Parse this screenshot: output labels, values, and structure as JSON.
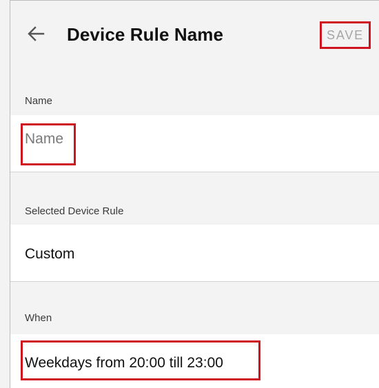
{
  "toolbar": {
    "back_icon": "arrow-left-icon",
    "title": "Device Rule Name",
    "save_label": "SAVE"
  },
  "name_section": {
    "header": "Name",
    "placeholder": "Name",
    "value": ""
  },
  "rule_section": {
    "header": "Selected Device Rule",
    "value": "Custom"
  },
  "when_section": {
    "header": "When",
    "value": "Weekdays from 20:00 till 23:00"
  },
  "colors": {
    "highlight": "#d0141f",
    "background": "#f3f3f3",
    "row_background": "#ffffff",
    "disabled_text": "#a5a5a5"
  }
}
